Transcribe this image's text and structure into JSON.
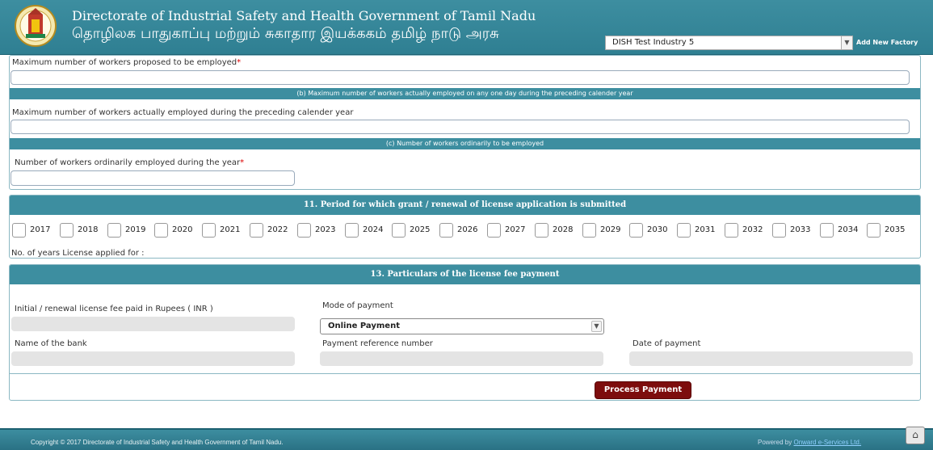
{
  "header": {
    "title_en": "Directorate of Industrial Safety and Health Government of Tamil Nadu",
    "title_ta": "தொழிலக பாதுகாப்பு மற்றும் சுகாதார இயக்ககம் தமிழ் நாடு அரசு",
    "factory_selected": "DISH Test Industry 5",
    "add_factory": "Add New Factory"
  },
  "workers": {
    "max_proposed_label": "Maximum number of workers proposed to be employed",
    "max_proposed_value": "",
    "sub_b": "(b) Maximum number of workers actually employed on any one day during the preceding calender year",
    "max_actual_label": "Maximum number of workers actually employed during the preceding calender year",
    "max_actual_value": "",
    "sub_c": "(c) Number of workers ordinarily to be employed",
    "ordinary_label": "Number of workers ordinarily employed during the year",
    "ordinary_value": ""
  },
  "period": {
    "heading": "11. Period for which grant / renewal of license application is submitted",
    "years": [
      "2017",
      "2018",
      "2019",
      "2020",
      "2021",
      "2022",
      "2023",
      "2024",
      "2025",
      "2026",
      "2027",
      "2028",
      "2029",
      "2030",
      "2031",
      "2032",
      "2033",
      "2034",
      "2035"
    ],
    "years_applied_label": "No. of years License applied for :"
  },
  "payment": {
    "heading": "13. Particulars of the license fee payment",
    "fee_label": "Initial / renewal license fee paid in Rupees ( INR )",
    "mode_label": "Mode of payment",
    "mode_value": "Online Payment",
    "bank_label": "Name of the bank",
    "ref_label": "Payment reference number",
    "date_label": "Date of payment",
    "process_button": "Process Payment"
  },
  "footer": {
    "copyright": "Copyright © 2017 Directorate of Industrial Safety and Health Government of Tamil Nadu.",
    "powered_prefix": "Powered by",
    "powered_link": "Onward e-Services Ltd."
  },
  "icons": {
    "logo": "tamil-nadu-emblem",
    "dropdown": "chevron-down-icon",
    "scroll_top": "home-up-icon"
  }
}
